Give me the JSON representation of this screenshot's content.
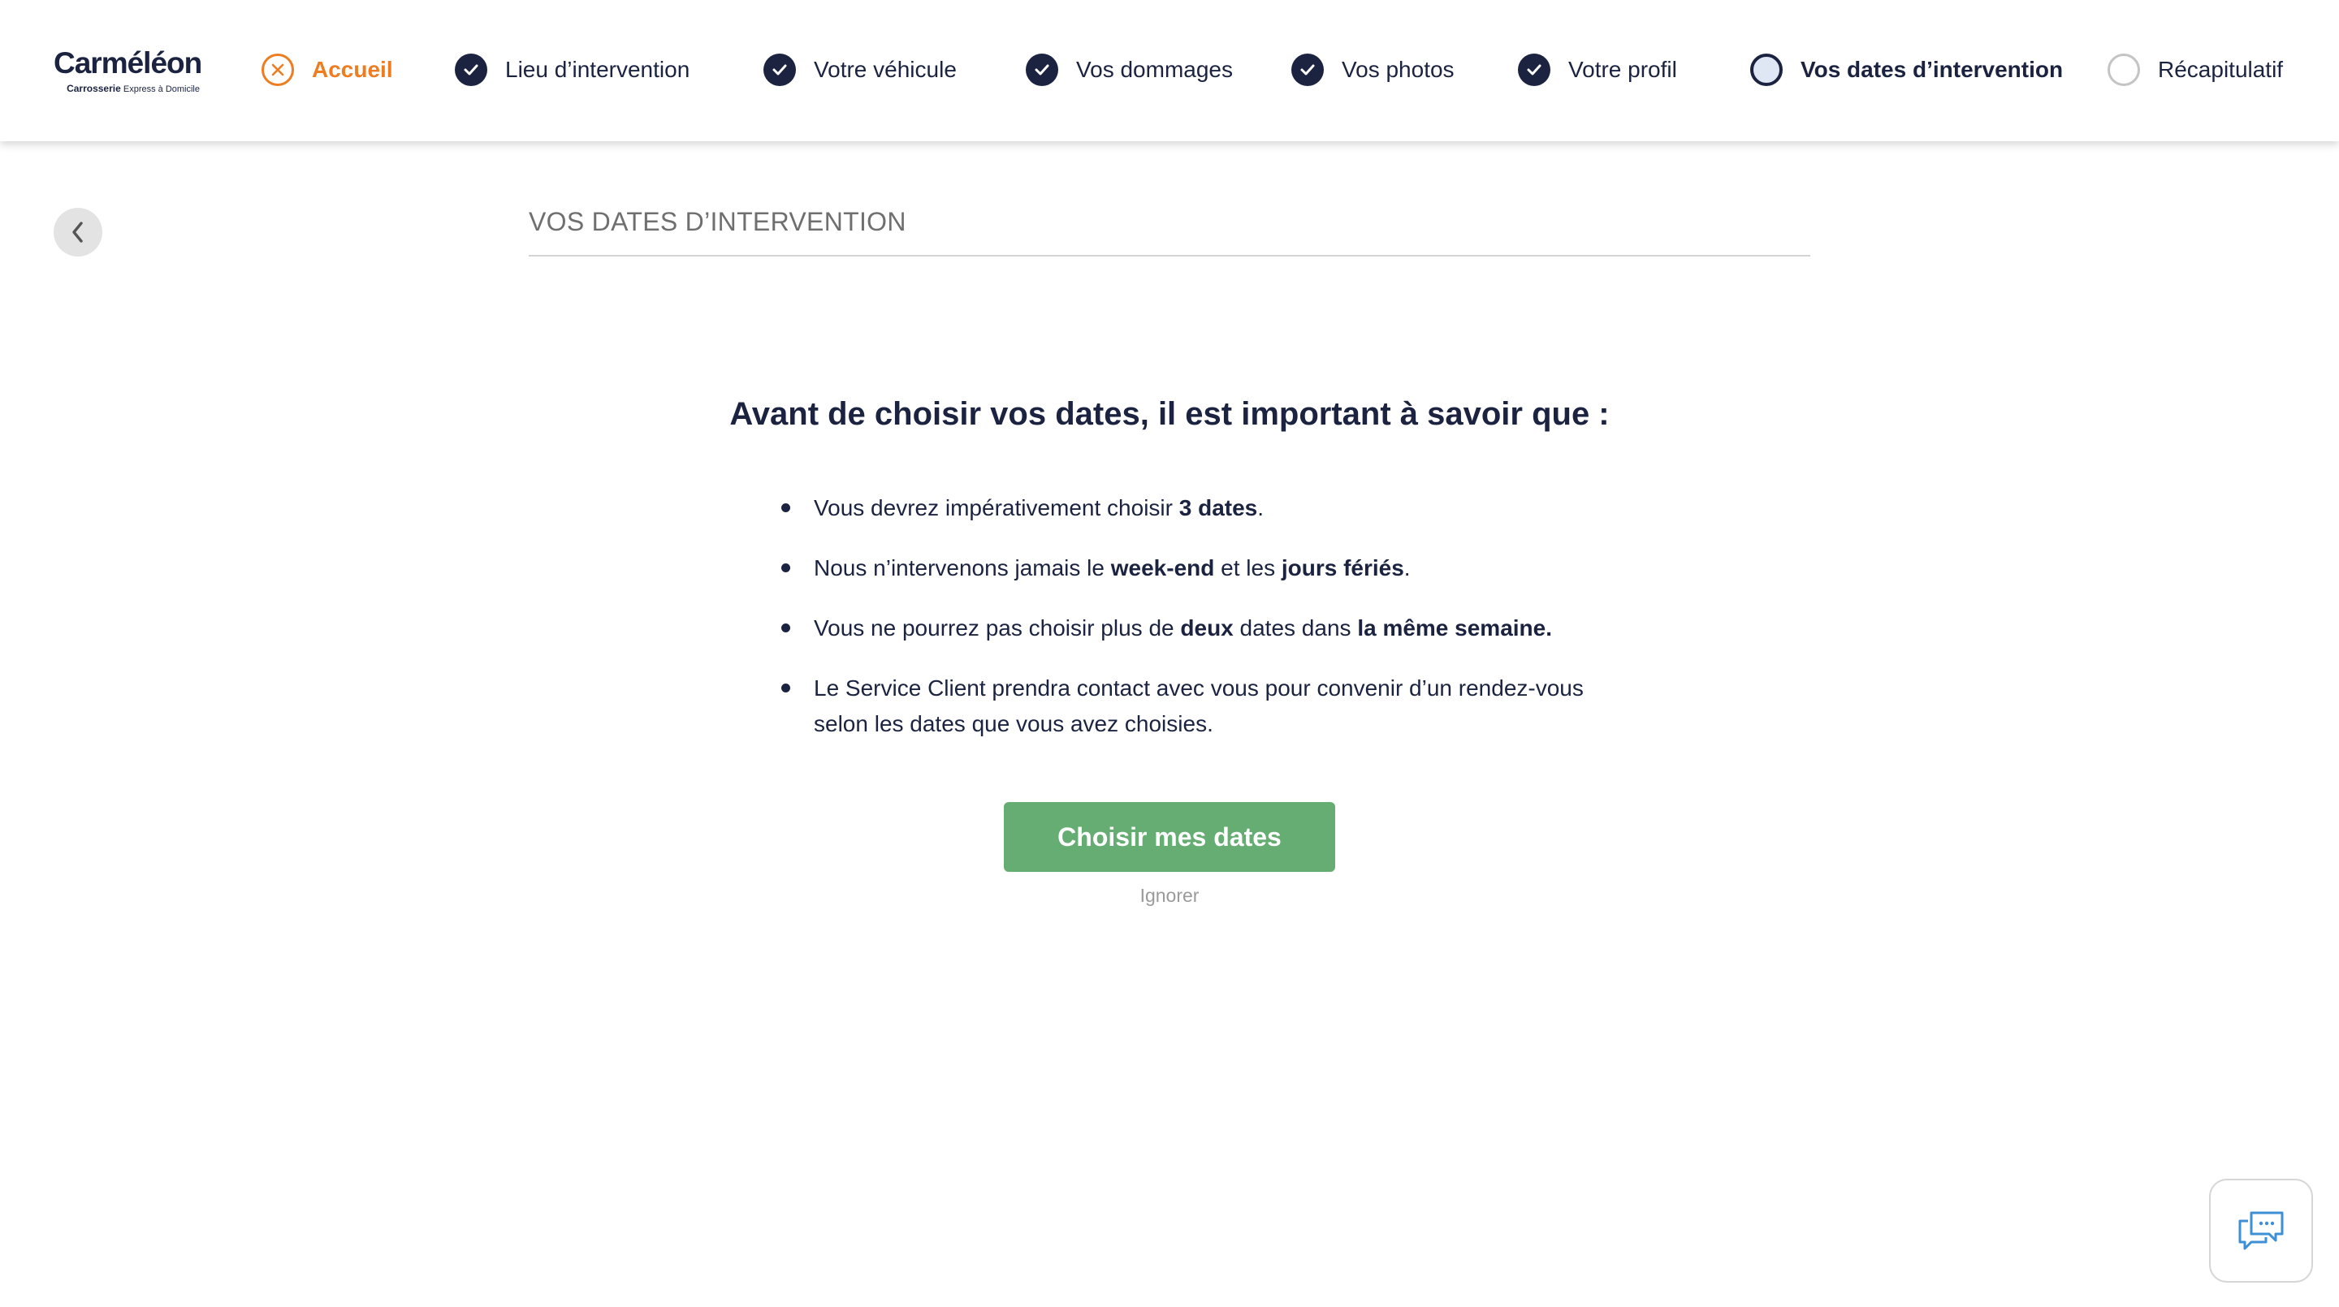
{
  "brand": {
    "name": "Carméléon",
    "tagline_bold": "Carrosserie",
    "tagline_rest": "Express à Domicile"
  },
  "steps": [
    {
      "label": "Accueil",
      "state": "cancel"
    },
    {
      "label": "Lieu d’intervention",
      "state": "done"
    },
    {
      "label": "Votre véhicule",
      "state": "done"
    },
    {
      "label": "Vos dommages",
      "state": "done"
    },
    {
      "label": "Vos photos",
      "state": "done"
    },
    {
      "label": "Votre profil",
      "state": "done"
    },
    {
      "label": "Vos dates d’intervention",
      "state": "current"
    },
    {
      "label": "Récapitulatif",
      "state": "todo"
    }
  ],
  "icons": {
    "back": "chevron-left-icon",
    "done": "check-icon",
    "cancel": "close-circle-icon",
    "chat": "chat-icon"
  },
  "colors": {
    "navy": "#1b2340",
    "orange": "#ee7d22",
    "green": "#66ad73",
    "current_fill": "#dfe7f4",
    "chat_icon": "#3d8fd6"
  },
  "section": {
    "title": "VOS DATES D’INTERVENTION"
  },
  "info": {
    "heading": "Avant de choisir vos dates, il est important à savoir que :",
    "rule1": {
      "a": "Vous devrez impérativement choisir ",
      "b": "3 dates",
      "c": "."
    },
    "rule2": {
      "a": "Nous n’intervenons jamais le ",
      "b": "week-end",
      "c": " et les ",
      "d": "jours fériés",
      "e": "."
    },
    "rule3": {
      "a": "Vous ne pourrez pas choisir plus de ",
      "b": "deux",
      "c": " dates dans ",
      "d": "la même semaine."
    },
    "rule4": {
      "line1": "Le Service Client prendra contact avec vous pour convenir d’un rendez-vous",
      "line2": "selon les dates que vous avez choisies."
    }
  },
  "actions": {
    "choose": "Choisir mes dates",
    "ignore": "Ignorer"
  }
}
